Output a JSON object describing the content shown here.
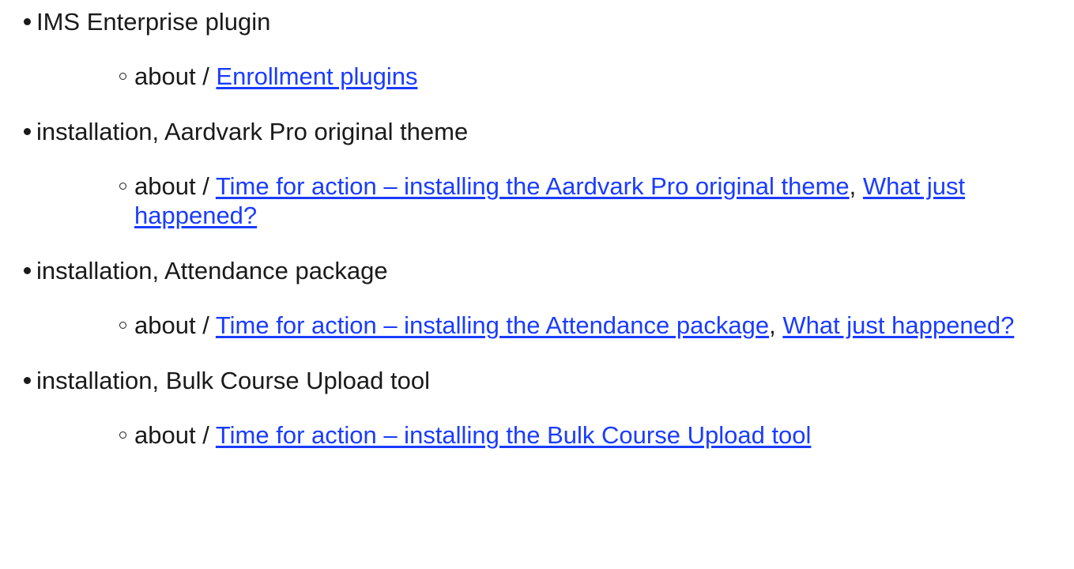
{
  "entries": [
    {
      "term": "IMS Enterprise plugin",
      "sub": {
        "prefix": "about / ",
        "links": [
          "Enrollment plugins"
        ],
        "separator": ""
      }
    },
    {
      "term": "installation, Aardvark Pro original theme",
      "sub": {
        "prefix": "about / ",
        "links": [
          "Time for action – installing the Aardvark Pro original theme",
          "What just happened?"
        ],
        "separator": ", "
      }
    },
    {
      "term": "installation, Attendance package",
      "sub": {
        "prefix": "about / ",
        "links": [
          "Time for action – installing the Attendance package",
          "What just happened?"
        ],
        "separator": ", "
      }
    },
    {
      "term": "installation, Bulk Course Upload tool",
      "sub": {
        "prefix": "about / ",
        "links": [
          "Time for action – installing the Bulk Course Upload tool"
        ],
        "separator": ""
      }
    }
  ],
  "colors": {
    "text": "#1a1a1a",
    "link": "#1a3cff"
  }
}
